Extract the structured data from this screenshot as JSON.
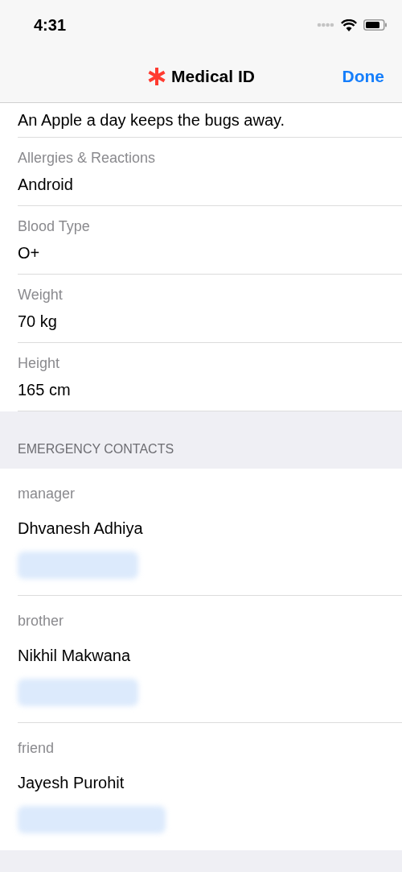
{
  "status_bar": {
    "time": "4:31"
  },
  "nav": {
    "title": "Medical ID",
    "done": "Done"
  },
  "fields": [
    {
      "value": "An Apple a day keeps the bugs away."
    },
    {
      "label": "Allergies & Reactions",
      "value": "Android"
    },
    {
      "label": "Blood Type",
      "value": "O+"
    },
    {
      "label": "Weight",
      "value": "70 kg"
    },
    {
      "label": "Height",
      "value": "165 cm"
    }
  ],
  "emergency_contacts": {
    "header": "EMERGENCY CONTACTS",
    "contacts": [
      {
        "relation": "manager",
        "name": "Dhvanesh Adhiya"
      },
      {
        "relation": "brother",
        "name": "Nikhil Makwana"
      },
      {
        "relation": "friend",
        "name": "Jayesh Purohit"
      }
    ]
  }
}
